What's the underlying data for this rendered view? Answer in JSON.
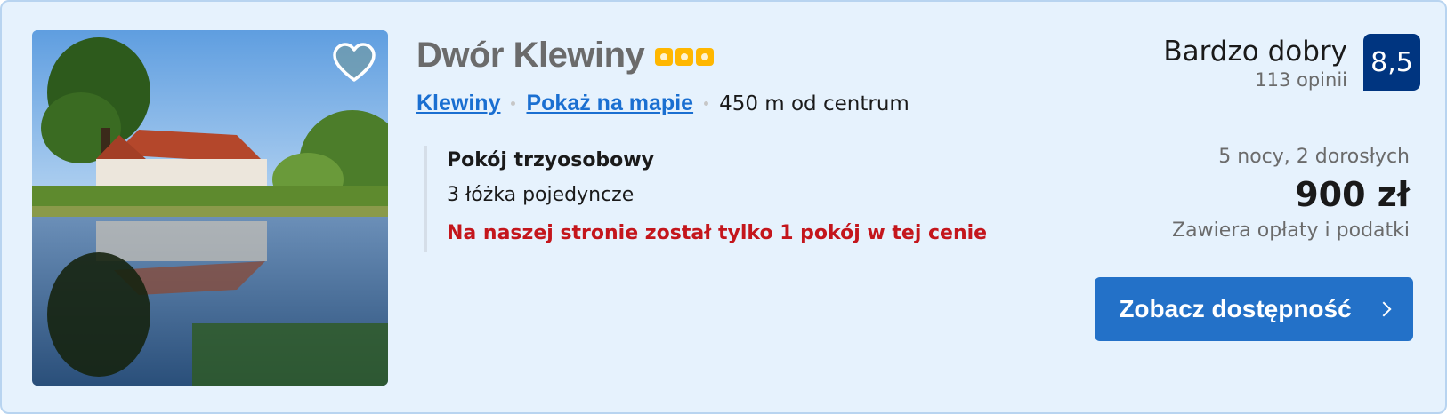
{
  "hotel": {
    "name": "Dwór Klewiny",
    "star_count": 3,
    "location_link": "Klewiny",
    "map_link": "Pokaż na mapie",
    "distance": "450 m od centrum"
  },
  "room": {
    "name": "Pokój trzyosobowy",
    "beds": "3 łóżka pojedyncze",
    "warning": "Na naszej stronie został tylko 1 pokój w tej cenie"
  },
  "review": {
    "word": "Bardzo dobry",
    "count": "113 opinii",
    "score": "8,5"
  },
  "pricing": {
    "stay": "5 nocy, 2 dorosłych",
    "price": "900 zł",
    "taxes": "Zawiera opłaty i podatki"
  },
  "cta": {
    "label": "Zobacz dostępność"
  },
  "icons": {
    "favorite": "heart-icon",
    "cta_arrow": "chevron-right-icon",
    "rating": "star-icon"
  },
  "colors": {
    "card_bg": "#e6f2fd",
    "accent": "#2371c8",
    "score_bg": "#003580",
    "warning": "#c4161c",
    "star": "#ffb700"
  }
}
